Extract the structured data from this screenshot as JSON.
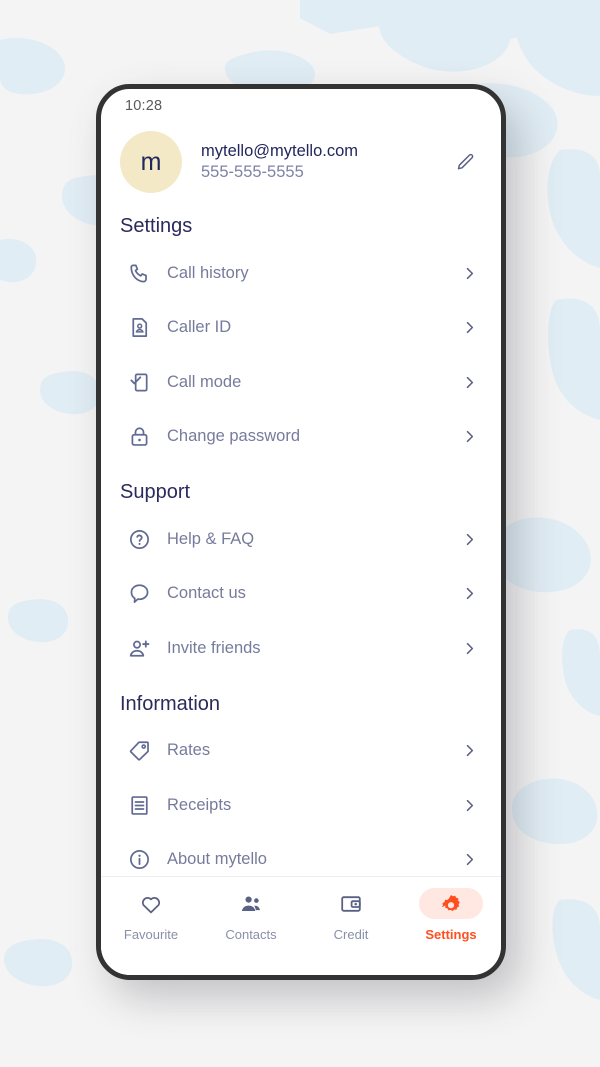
{
  "background": {
    "color": "#f4f4f4",
    "map_color": "#e3eef5",
    "watermark_name": "world-map-watermark"
  },
  "theme": {
    "accent": "#ff4f1f",
    "accent_pill": "#ffe8e1",
    "heading": "#2a2a5c",
    "label": "#767b9c",
    "icon": "#616a92",
    "avatar_bg": "#f3e9c6",
    "device_frame": "#333333"
  },
  "status_bar": {
    "time": "10:28"
  },
  "account": {
    "avatar_letter": "m",
    "email": "mytello@mytello.com",
    "phone": "555-555-5555",
    "edit_icon": "pencil-icon"
  },
  "sections": [
    {
      "title": "Settings",
      "items": [
        {
          "label": "Call history",
          "icon": "phone-icon",
          "chevron": "chevron-right-icon"
        },
        {
          "label": "Caller ID",
          "icon": "id-card-icon",
          "chevron": "chevron-right-icon"
        },
        {
          "label": "Call mode",
          "icon": "phone-check-icon",
          "chevron": "chevron-right-icon"
        },
        {
          "label": "Change password",
          "icon": "lock-icon",
          "chevron": "chevron-right-icon"
        }
      ]
    },
    {
      "title": "Support",
      "items": [
        {
          "label": "Help & FAQ",
          "icon": "question-circle-icon",
          "chevron": "chevron-right-icon"
        },
        {
          "label": "Contact us",
          "icon": "chat-bubble-icon",
          "chevron": "chevron-right-icon"
        },
        {
          "label": "Invite friends",
          "icon": "person-plus-icon",
          "chevron": "chevron-right-icon"
        }
      ]
    },
    {
      "title": "Information",
      "items": [
        {
          "label": "Rates",
          "icon": "tag-icon",
          "chevron": "chevron-right-icon"
        },
        {
          "label": "Receipts",
          "icon": "receipt-icon",
          "chevron": "chevron-right-icon"
        },
        {
          "label": "About mytello",
          "icon": "info-circle-icon",
          "chevron": "chevron-right-icon"
        }
      ]
    }
  ],
  "bottom_nav": {
    "items": [
      {
        "label": "Favourite",
        "icon": "heart-icon",
        "active": false
      },
      {
        "label": "Contacts",
        "icon": "people-icon",
        "active": false
      },
      {
        "label": "Credit",
        "icon": "wallet-icon",
        "active": false
      },
      {
        "label": "Settings",
        "icon": "gear-icon",
        "active": true
      }
    ]
  }
}
